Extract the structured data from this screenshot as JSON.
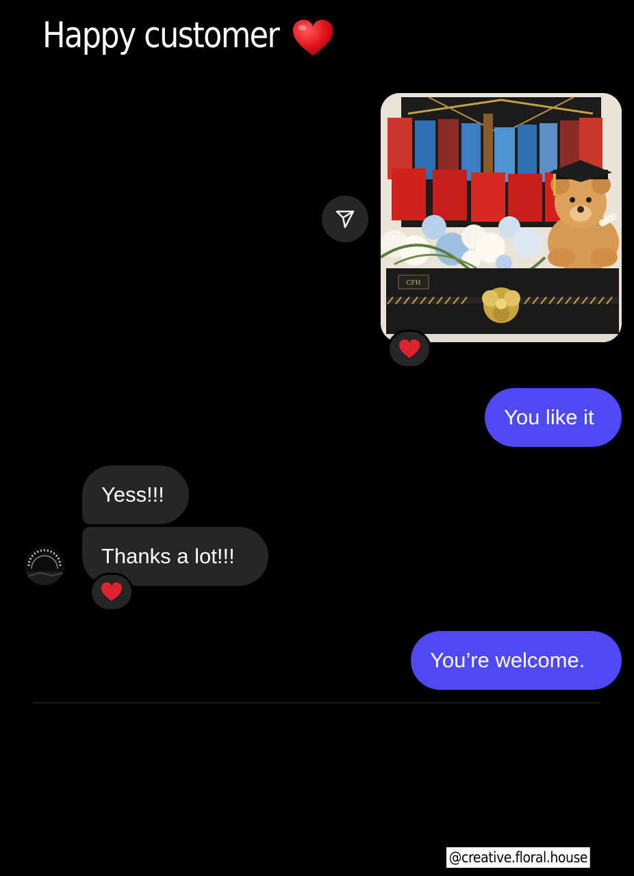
{
  "story": {
    "title": "Happy customer",
    "title_emoji": "heart-emoji",
    "handle": "@creative.floral.house"
  },
  "conversation": {
    "messages": [
      {
        "id": "shared-photo",
        "sender": "me",
        "type": "image",
        "reaction": "heart-emoji"
      },
      {
        "id": "msg-1",
        "sender": "me",
        "text": "You like it"
      },
      {
        "id": "msg-2",
        "sender": "customer",
        "text": "Yess!!!"
      },
      {
        "id": "msg-3",
        "sender": "customer",
        "text": "Thanks a lot!!!",
        "reaction": "heart-emoji"
      },
      {
        "id": "msg-4",
        "sender": "me",
        "text": "You’re welcome."
      }
    ]
  },
  "colors": {
    "background": "#000000",
    "outgoing_bubble": "#4f48f5",
    "incoming_bubble": "#262626",
    "reaction_heart": "#e0242f"
  },
  "icons": {
    "share": "paper-plane-icon",
    "reaction": "heart-emoji"
  }
}
